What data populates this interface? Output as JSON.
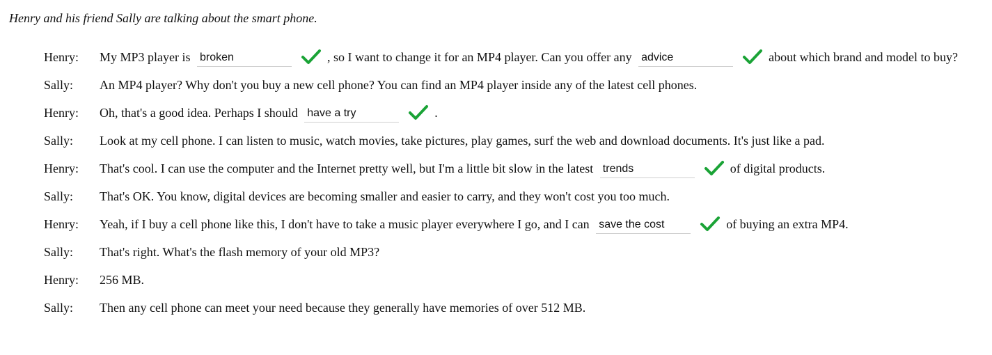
{
  "intro": "Henry and his friend Sally are talking about the smart phone.",
  "lines": [
    {
      "speaker": "Henry:",
      "parts": [
        "My MP3 player is",
        {
          "blank": "broken",
          "correct": true
        },
        ", so I want to change it for an MP4 player. Can you offer any",
        {
          "blank": "advice",
          "correct": true
        },
        "about which brand and model to buy?"
      ]
    },
    {
      "speaker": "Sally:",
      "parts": [
        "An MP4 player? Why don't you buy a new cell phone? You can find an MP4 player inside any of the latest cell phones."
      ]
    },
    {
      "speaker": "Henry:",
      "parts": [
        "Oh, that's a good idea. Perhaps I should",
        {
          "blank": "have a try",
          "correct": true
        },
        "."
      ]
    },
    {
      "speaker": "Sally:",
      "parts": [
        "Look at my cell phone. I can listen to music, watch movies, take pictures, play games, surf the web and download documents. It's just like a pad."
      ]
    },
    {
      "speaker": "Henry:",
      "parts": [
        "That's cool. I can use the computer and the Internet pretty well, but I'm a little bit slow in the latest",
        {
          "blank": "trends",
          "correct": true
        },
        "of digital products."
      ]
    },
    {
      "speaker": "Sally:",
      "parts": [
        "That's OK. You know, digital devices are becoming smaller and easier to carry, and they won't cost you too much."
      ]
    },
    {
      "speaker": "Henry:",
      "parts": [
        "Yeah, if I buy a cell phone like this, I don't have to take a music player everywhere I go, and I can",
        {
          "blank": "save the cost",
          "correct": true
        },
        "of buying an extra MP4."
      ]
    },
    {
      "speaker": "Sally:",
      "parts": [
        "That's right. What's the flash memory of your old MP3?"
      ]
    },
    {
      "speaker": "Henry:",
      "parts": [
        "256 MB."
      ]
    },
    {
      "speaker": "Sally:",
      "parts": [
        "Then any cell phone can meet your need because they generally have memories of over 512 MB."
      ]
    }
  ],
  "colors": {
    "check": "#1aa336"
  },
  "icons": {
    "correct": "checkmark-icon"
  }
}
